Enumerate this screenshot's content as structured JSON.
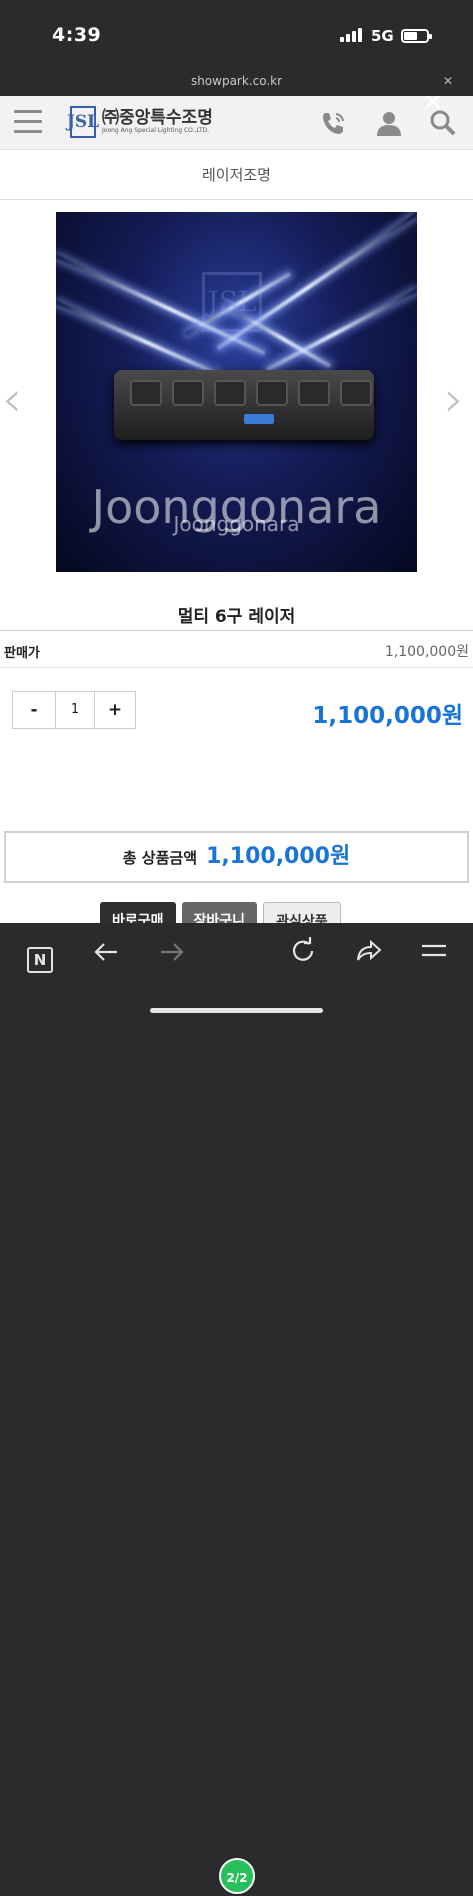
{
  "status_bar": {
    "time": "4:39",
    "network": "5G"
  },
  "url_bar": {
    "domain": "showpark.co.kr",
    "close_symbol": "✕"
  },
  "header": {
    "logo_mark": "JSL",
    "logo_korean": "㈜중앙특수조명",
    "logo_english": "Joong Ang Special Lighting CO.,LTD."
  },
  "category": {
    "title": "레이저조명"
  },
  "product": {
    "name": "멀티 6구 레이저",
    "watermark_large": "Joonggonara",
    "watermark_small": "Joonggonara",
    "image_logo": "JSL",
    "prev_arrow": "‹",
    "next_arrow": "›"
  },
  "price": {
    "label": "판매가",
    "value": "1,100,000원"
  },
  "quantity": {
    "minus": "-",
    "value": "1",
    "plus": "+",
    "line_total": "1,100,000원"
  },
  "total": {
    "label": "총 상품금액",
    "value": "1,100,000원"
  },
  "buttons": {
    "buy_now": "바로구매",
    "cart": "장바구니",
    "wishlist": "관심상품"
  },
  "browser_toolbar": {
    "tab_count": "2/2",
    "naver_label": "N"
  },
  "colors": {
    "accent_blue": "#1a73d6",
    "tab_green": "#27c05c"
  }
}
